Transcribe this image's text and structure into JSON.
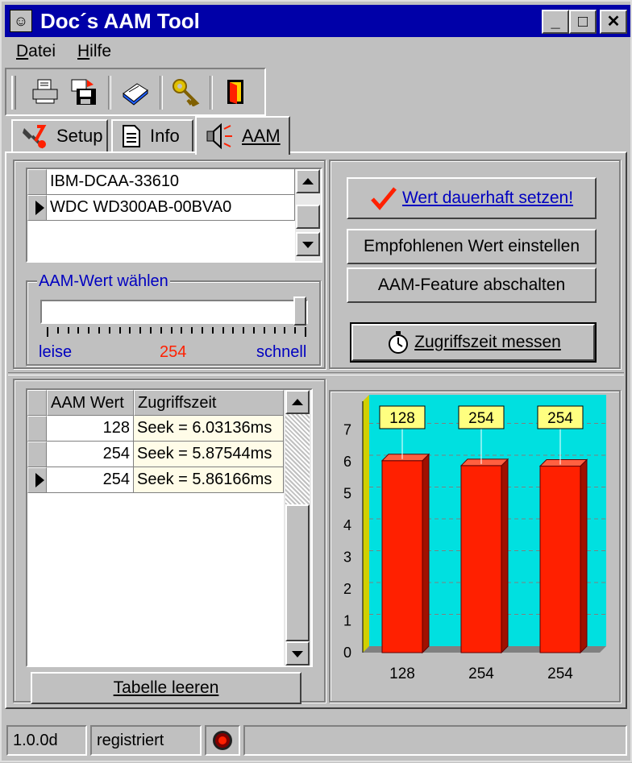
{
  "window": {
    "title": "Doc´s AAM Tool",
    "app_icon": "smiley-icon"
  },
  "title_buttons": [
    "_",
    "□",
    "✕"
  ],
  "menu": [
    {
      "label_u": "D",
      "label_rest": "atei"
    },
    {
      "label_u": "H",
      "label_rest": "ilfe"
    }
  ],
  "toolbar": {
    "icons": [
      "print-icon",
      "save-icon",
      "book-icon",
      "key-icon",
      "exit-door-icon"
    ]
  },
  "tabs": [
    {
      "label": "Setup",
      "icon": "tools-icon",
      "active": false
    },
    {
      "label": "Info",
      "icon": "document-icon",
      "active": false
    },
    {
      "label": "AAM",
      "icon": "speaker-icon",
      "active": true
    }
  ],
  "drives": [
    "IBM-DCAA-33610",
    "WDC WD300AB-00BVA0"
  ],
  "selected_drive_index": 1,
  "aam_group": {
    "title": "AAM-Wert wählen",
    "label_left": "leise",
    "value": "254",
    "label_right": "schnell",
    "slider_fraction": 1.0
  },
  "buttons": {
    "set_permanent": "Wert dauerhaft setzen!",
    "recommended": "Empfohlenen Wert einstellen",
    "disable": "AAM-Feature abschalten",
    "measure": "Zugriffszeit messen",
    "clear_table": "Tabelle leeren"
  },
  "table": {
    "headers": [
      "AAM Wert",
      "Zugriffszeit"
    ],
    "rows": [
      {
        "aam": "128",
        "time": "Seek = 6.03136ms"
      },
      {
        "aam": "254",
        "time": "Seek = 5.87544ms"
      },
      {
        "aam": "254",
        "time": "Seek = 5.86166ms"
      }
    ],
    "current_row": 2
  },
  "chart_data": {
    "type": "bar",
    "categories": [
      "128",
      "254",
      "254"
    ],
    "values": [
      6.03136,
      5.87544,
      5.86166
    ],
    "data_labels": [
      "128",
      "254",
      "254"
    ],
    "y_ticks": [
      "0",
      "1",
      "2",
      "3",
      "4",
      "5",
      "6",
      "7"
    ],
    "ylim": [
      0,
      8
    ],
    "grid": true,
    "colors": {
      "bar": "#ff2000",
      "background": "#00e0e0",
      "label_box": "#ffff80"
    }
  },
  "status": {
    "version": "1.0.0d",
    "state": "registriert",
    "indicator": "led-red-icon"
  }
}
